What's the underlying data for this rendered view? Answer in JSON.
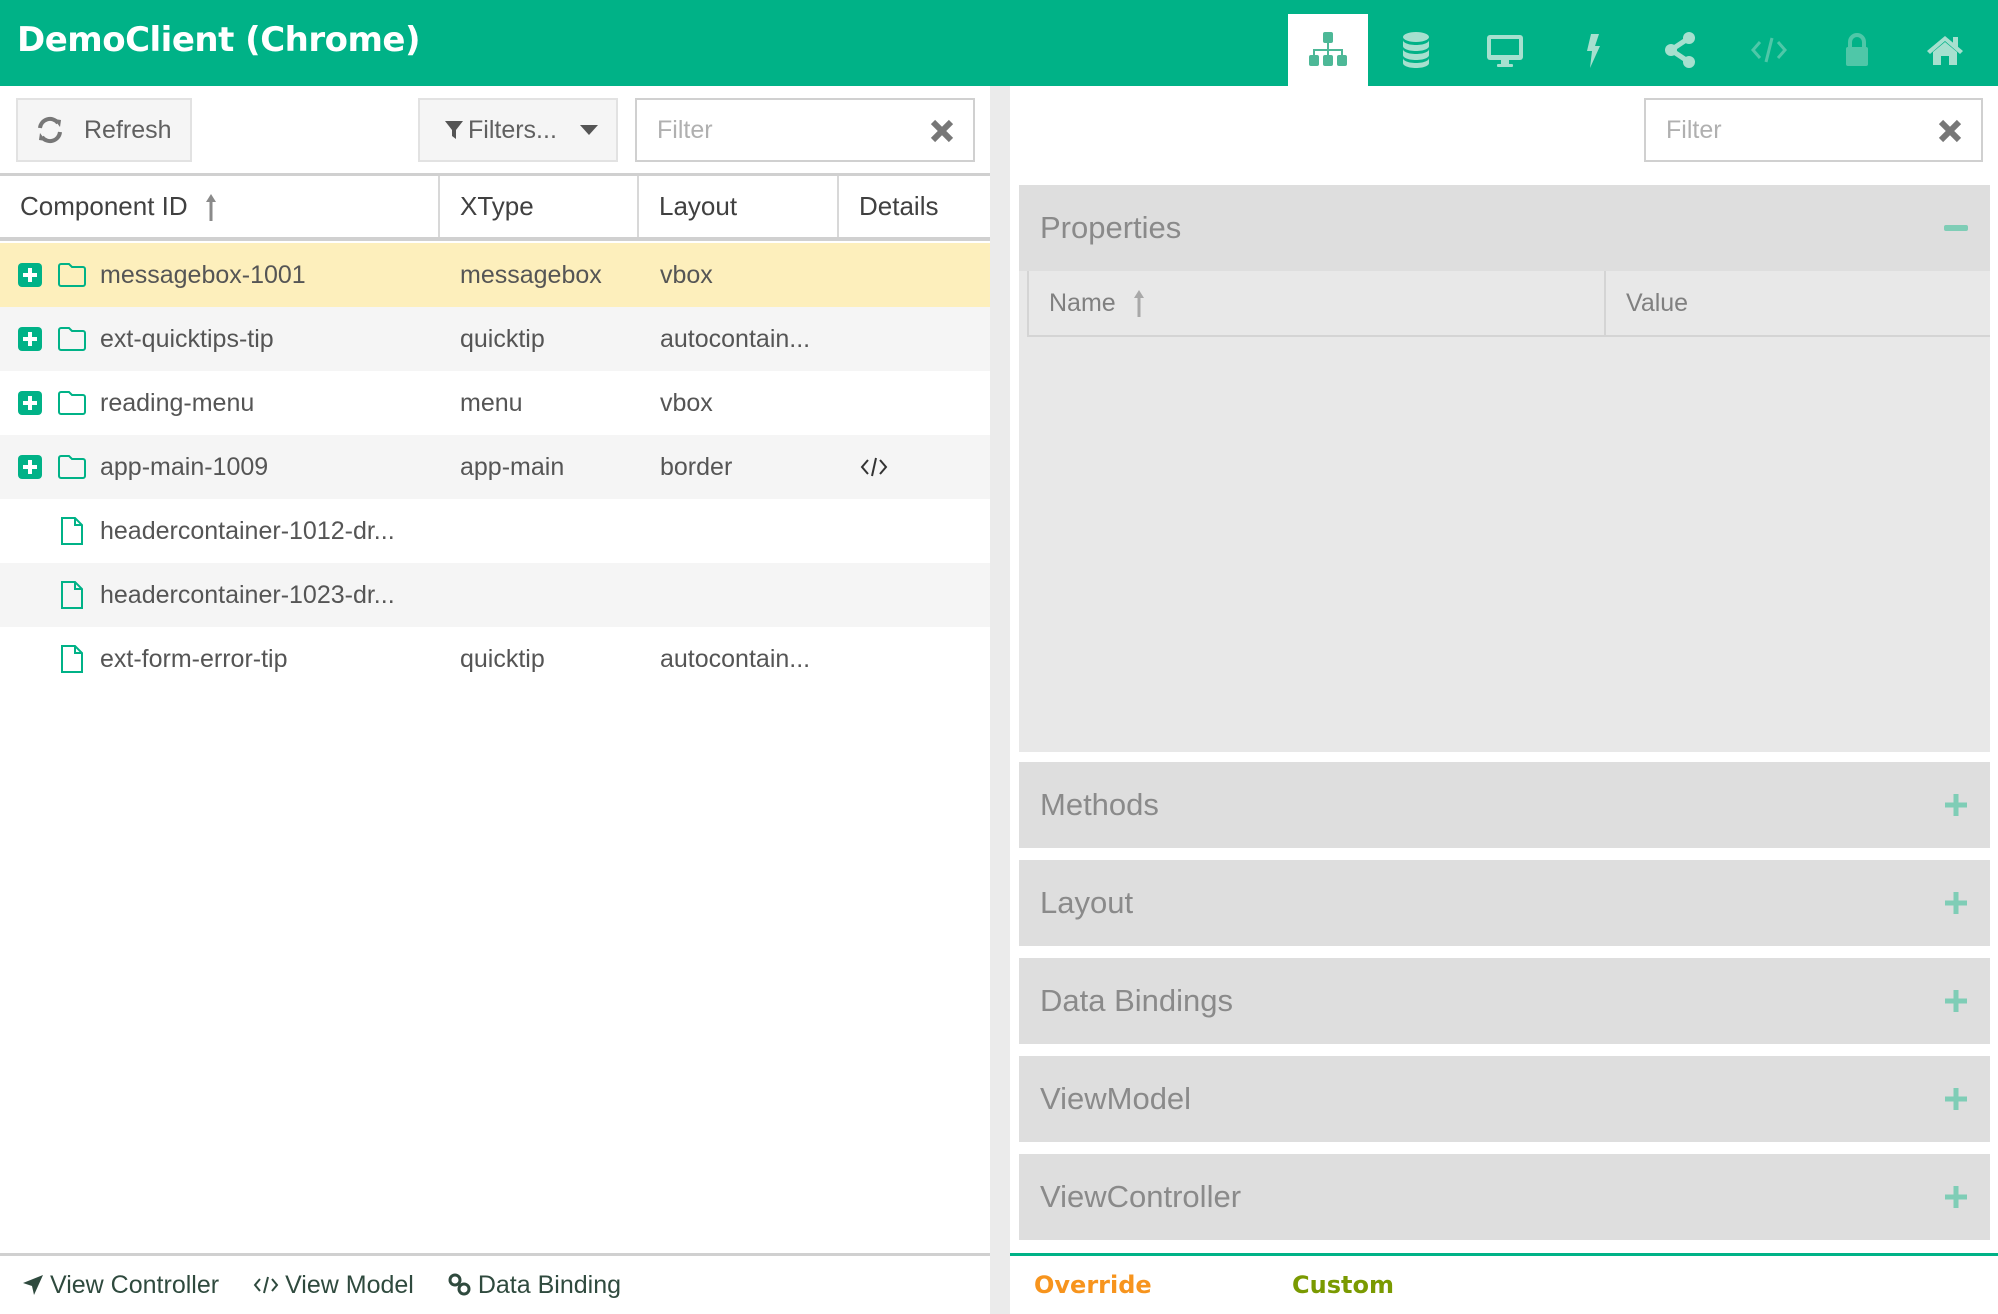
{
  "app": {
    "title": "DemoClient (Chrome)",
    "accent_color": "#00b287",
    "nav_tabs": [
      {
        "icon": "sitemap-icon",
        "label": "Components",
        "active": true,
        "enabled": true
      },
      {
        "icon": "database-icon",
        "label": "Stores",
        "active": false,
        "enabled": true
      },
      {
        "icon": "desktop-icon",
        "label": "App",
        "active": false,
        "enabled": true
      },
      {
        "icon": "bolt-icon",
        "label": "Events",
        "active": false,
        "enabled": true
      },
      {
        "icon": "share-icon",
        "label": "Share",
        "active": false,
        "enabled": true
      },
      {
        "icon": "code-icon",
        "label": "Code",
        "active": false,
        "enabled": false
      },
      {
        "icon": "lock-icon",
        "label": "Lock",
        "active": false,
        "enabled": false
      },
      {
        "icon": "home-icon",
        "label": "Home",
        "active": false,
        "enabled": true
      }
    ]
  },
  "left": {
    "toolbar": {
      "refresh_label": "Refresh",
      "filters_label": "Filters...",
      "filter_placeholder": "Filter",
      "filter_value": ""
    },
    "columns": {
      "component_id": "Component ID",
      "xtype": "XType",
      "layout": "Layout",
      "details": "Details",
      "sorted_by": "Component ID",
      "sort_direction": "asc"
    },
    "rows": [
      {
        "id": "messagebox-1001",
        "xtype": "messagebox",
        "layout": "vbox",
        "details": "",
        "expandable": true,
        "type": "folder",
        "selected": true
      },
      {
        "id": "ext-quicktips-tip",
        "xtype": "quicktip",
        "layout": "autocontain...",
        "details": "",
        "expandable": true,
        "type": "folder",
        "selected": false
      },
      {
        "id": "reading-menu",
        "xtype": "menu",
        "layout": "vbox",
        "details": "",
        "expandable": true,
        "type": "folder",
        "selected": false
      },
      {
        "id": "app-main-1009",
        "xtype": "app-main",
        "layout": "border",
        "details": "</>",
        "expandable": true,
        "type": "folder",
        "selected": false
      },
      {
        "id": "headercontainer-1012-dr...",
        "xtype": "",
        "layout": "",
        "details": "",
        "expandable": false,
        "type": "file",
        "selected": false
      },
      {
        "id": "headercontainer-1023-dr...",
        "xtype": "",
        "layout": "",
        "details": "",
        "expandable": false,
        "type": "file",
        "selected": false
      },
      {
        "id": "ext-form-error-tip",
        "xtype": "quicktip",
        "layout": "autocontain...",
        "details": "",
        "expandable": false,
        "type": "file",
        "selected": false
      }
    ],
    "footer": {
      "view_controller": "View Controller",
      "view_model": "View Model",
      "data_binding": "Data Binding"
    }
  },
  "right": {
    "filter_placeholder": "Filter",
    "filter_value": "",
    "properties": {
      "title": "Properties",
      "expanded": true,
      "columns": {
        "name": "Name",
        "value": "Value"
      },
      "rows": []
    },
    "sections": [
      {
        "title": "Methods",
        "expanded": false
      },
      {
        "title": "Layout",
        "expanded": false
      },
      {
        "title": "Data Bindings",
        "expanded": false
      },
      {
        "title": "ViewModel",
        "expanded": false
      },
      {
        "title": "ViewController",
        "expanded": false
      }
    ],
    "legend": {
      "override_label": "Override",
      "override_color": "#f7941d",
      "custom_label": "Custom",
      "custom_color": "#7a9a01"
    }
  }
}
